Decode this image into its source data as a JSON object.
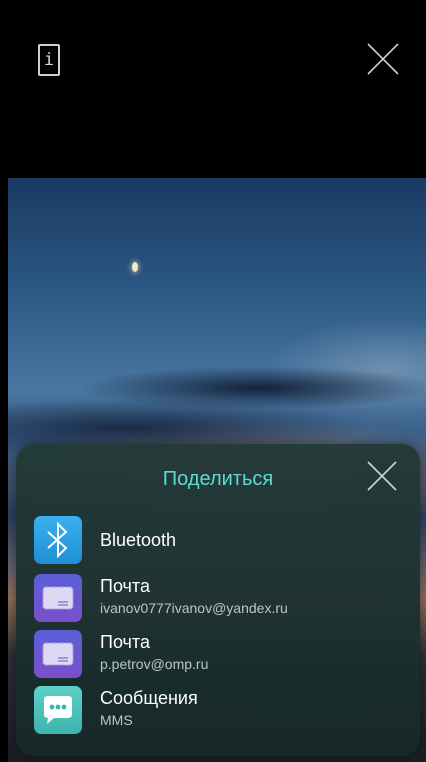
{
  "top_bar": {
    "info_glyph": "i",
    "info_icon": "info-icon",
    "close_icon": "close-icon"
  },
  "share_sheet": {
    "title": "Поделиться",
    "title_color": "#5fd9d4",
    "items": [
      {
        "label": "Bluetooth",
        "sublabel": "",
        "icon": "bluetooth-icon"
      },
      {
        "label": "Почта",
        "sublabel": "ivanov0777ivanov@yandex.ru",
        "icon": "mail-icon"
      },
      {
        "label": "Почта",
        "sublabel": "p.petrov@omp.ru",
        "icon": "mail-icon"
      },
      {
        "label": "Сообщения",
        "sublabel": "MMS",
        "icon": "message-icon"
      }
    ]
  }
}
